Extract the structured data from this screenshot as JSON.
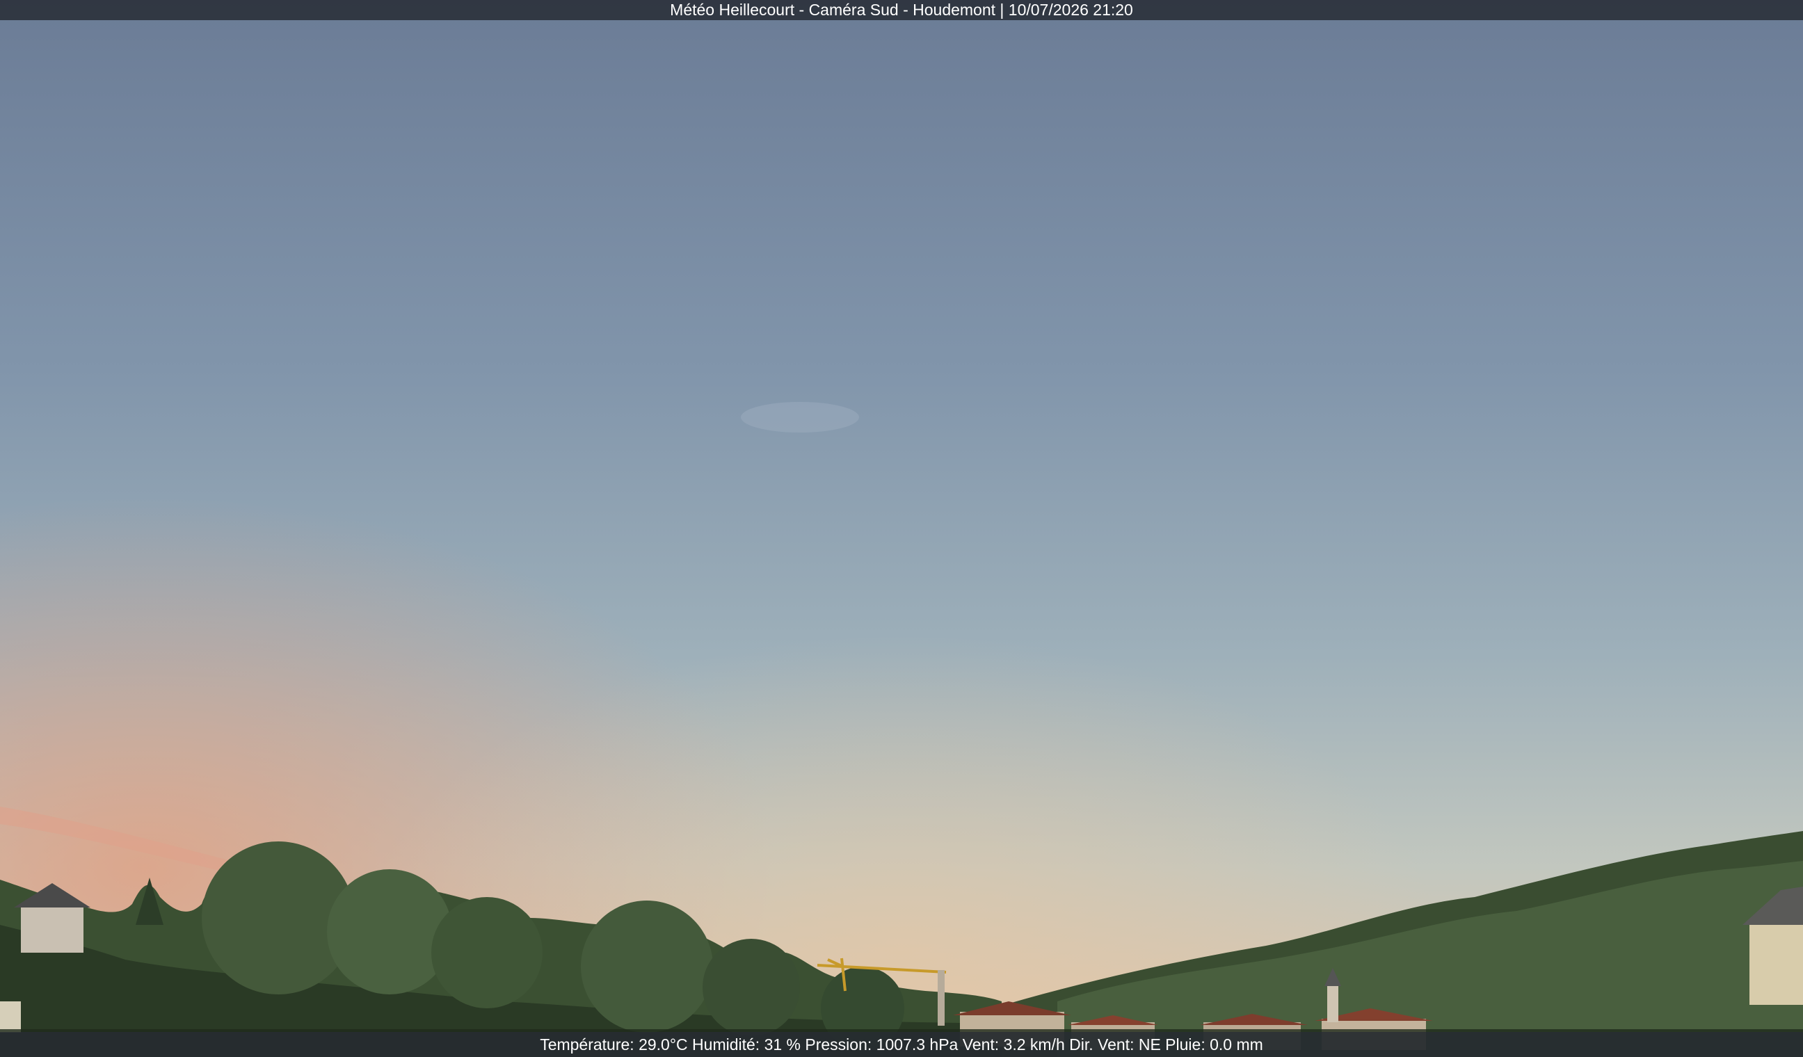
{
  "overlay": {
    "title": "Météo Heillecourt - Caméra Sud - Houdemont | 10/07/2026 21:20",
    "weather": "Température: 29.0°C  Humidité: 31 % Pression: 1007.3 hPa Vent: 3.2 km/h Dir. Vent: NE Pluie: 0.0 mm"
  },
  "colors": {
    "sky_top": "#6c7d97",
    "sky_mid": "#8da0b2",
    "sky_horizon": "#c6c9bf",
    "sunset_glow": "#d9a388",
    "trees_dark": "#263322",
    "trees_mid": "#3f5535",
    "trees_light": "#5f7a4d",
    "roofs": "#7a3c2c"
  }
}
